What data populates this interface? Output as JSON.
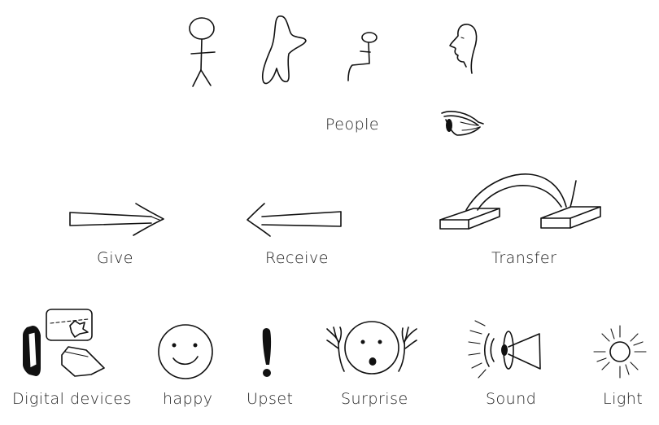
{
  "labels": {
    "people": "People",
    "give": "Give",
    "receive": "Receive",
    "transfer": "Transfer",
    "digital_devices": "Digital devices",
    "happy": "happy",
    "upset": "Upset",
    "surprise": "Surprise",
    "sound": "Sound",
    "light": "Light"
  }
}
